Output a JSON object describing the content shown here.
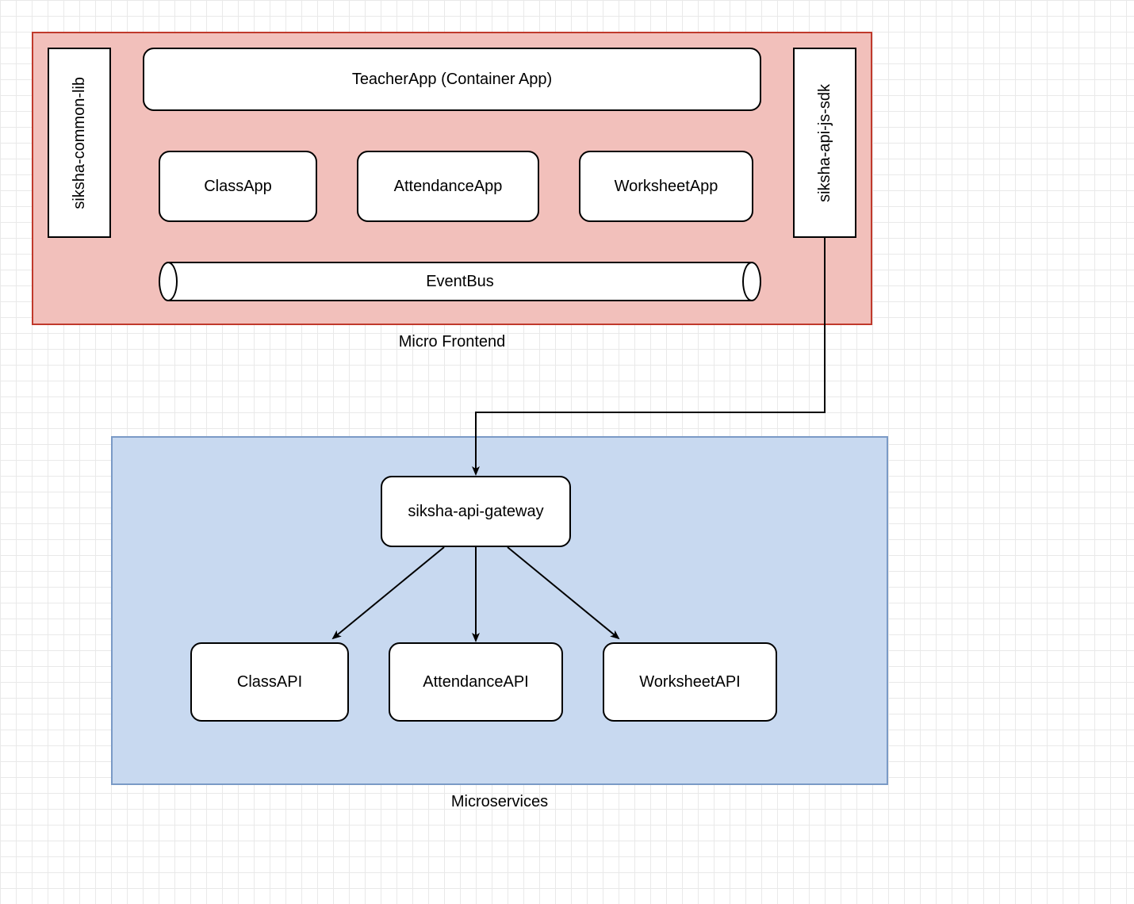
{
  "frontend": {
    "label": "Micro Frontend",
    "common_lib": "siksha-common-lib",
    "container_app": "TeacherApp (Container App)",
    "apps": {
      "class": "ClassApp",
      "attendance": "AttendanceApp",
      "worksheet": "WorksheetApp"
    },
    "event_bus": "EventBus",
    "sdk": "siksha-api-js-sdk"
  },
  "backend": {
    "label": "Microservices",
    "gateway": "siksha-api-gateway",
    "apis": {
      "class": "ClassAPI",
      "attendance": "AttendanceAPI",
      "worksheet": "WorksheetAPI"
    }
  },
  "colors": {
    "frontend_fill": "#f2c0bb",
    "frontend_border": "#c0392b",
    "backend_fill": "#c8d9f0",
    "backend_border": "#7a9ac6"
  }
}
